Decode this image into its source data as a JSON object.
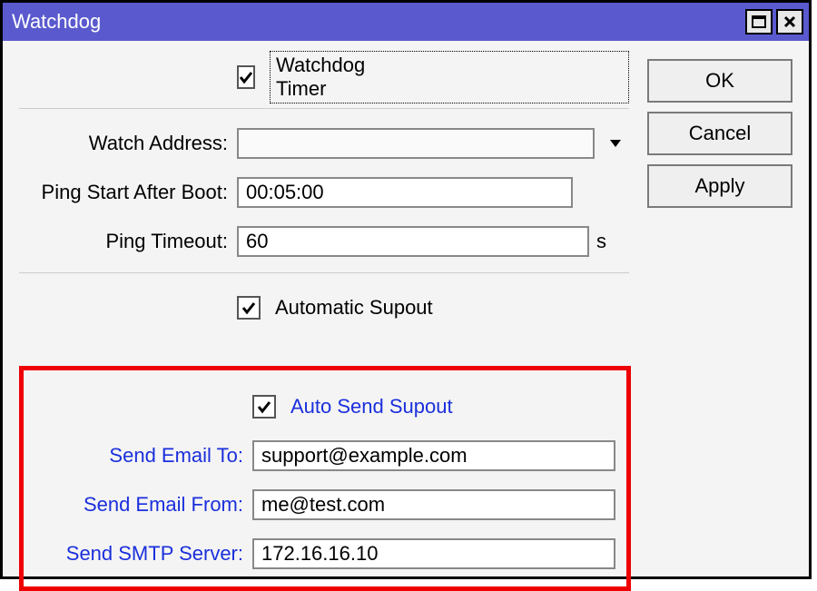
{
  "window": {
    "title": "Watchdog"
  },
  "buttons": {
    "ok": "OK",
    "cancel": "Cancel",
    "apply": "Apply"
  },
  "form": {
    "watchdog_timer": {
      "label": "Watchdog Timer",
      "checked": true
    },
    "watch_address": {
      "label": "Watch Address:",
      "value": ""
    },
    "ping_start_after_boot": {
      "label": "Ping Start After Boot:",
      "value": "00:05:00"
    },
    "ping_timeout": {
      "label": "Ping Timeout:",
      "value": "60",
      "unit": "s"
    },
    "automatic_supout": {
      "label": "Automatic Supout",
      "checked": true
    },
    "auto_send_supout": {
      "label": "Auto Send Supout",
      "checked": true
    },
    "send_email_to": {
      "label": "Send Email To:",
      "value": "support@example.com"
    },
    "send_email_from": {
      "label": "Send Email From:",
      "value": "me@test.com"
    },
    "send_smtp_server": {
      "label": "Send SMTP Server:",
      "value": "172.16.16.10"
    }
  }
}
